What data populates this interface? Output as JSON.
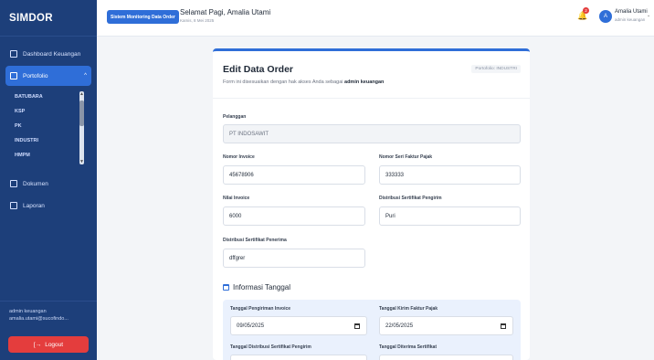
{
  "sidebar": {
    "brand": "SIMDOR",
    "nav": [
      {
        "label": "Dashboard Keuangan",
        "icon": "dashboard-icon"
      },
      {
        "label": "Portofolio",
        "icon": "folder-icon",
        "active": true
      },
      {
        "label": "Dokumen",
        "icon": "document-icon"
      },
      {
        "label": "Laporan",
        "icon": "chart-icon"
      }
    ],
    "sub_items": [
      "BATUBARA",
      "KSP",
      "PK",
      "INDUSTRI",
      "HMPM"
    ],
    "user_role": "admin keuangan",
    "user_email": "amalia.utami@sucofindo...",
    "logout_label": "Logout"
  },
  "topbar": {
    "system_badge": "Sistem Monitoring Data Order",
    "greeting": "Selamat Pagi, Amalia Utami",
    "date": "Kamis, 8 Mei 2025",
    "notif_count": "2",
    "avatar_letter": "A",
    "user_name": "Amalia Utami",
    "user_role": "admin keuangan"
  },
  "form": {
    "title": "Edit Data Order",
    "desc_prefix": "Form ini disesuaikan dengan hak akses Anda sebagai ",
    "desc_role": "admin keuangan",
    "portfolio_tag": "Portofolio: INDUSTRI",
    "pelanggan_label": "Pelanggan",
    "pelanggan_value": "PT INDOSAWIT",
    "invoice_label": "Nomor Invoice",
    "invoice_value": "45678906",
    "faktur_label": "Nomor Seri Faktur Pajak",
    "faktur_value": "333333",
    "nilai_label": "Nilai Invoice",
    "nilai_value": "6000",
    "dist_pengirim_label": "Distribusi Sertifikat Pengirim",
    "dist_pengirim_value": "Puri",
    "dist_penerima_label": "Distribusi Sertifikat Penerima",
    "dist_penerima_value": "dffgrer",
    "section_title": "Informasi Tanggal",
    "tgl_invoice_label": "Tanggal Pengiriman Invoice",
    "tgl_invoice_value": "09/05/2025",
    "tgl_faktur_label": "Tanggal Kirim Faktur Pajak",
    "tgl_faktur_value": "22/05/2025",
    "tgl_dist_label": "Tanggal Distribusi Sertifikat Pengirim",
    "tgl_diterima_label": "Tanggal Diterima Sertifikat"
  },
  "colors": {
    "sidebar": "#1d3f7a",
    "accent": "#2f6ed8",
    "logout": "#e43d3d"
  }
}
